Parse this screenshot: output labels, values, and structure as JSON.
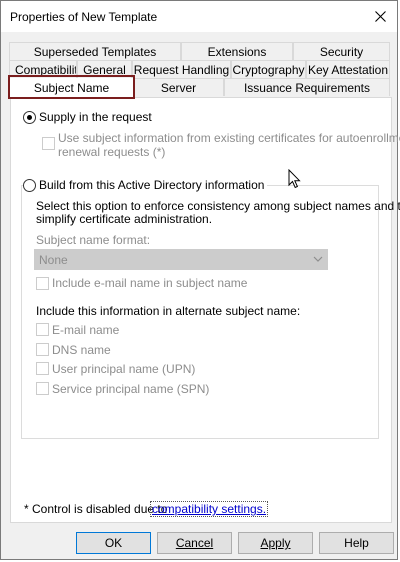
{
  "window": {
    "title": "Properties of New Template"
  },
  "tabs": {
    "row1": [
      {
        "label": "Superseded Templates"
      },
      {
        "label": "Extensions"
      },
      {
        "label": "Security"
      }
    ],
    "row2": [
      {
        "label": "Compatibility"
      },
      {
        "label": "General"
      },
      {
        "label": "Request Handling"
      },
      {
        "label": "Cryptography"
      },
      {
        "label": "Key Attestation"
      }
    ],
    "row3": [
      {
        "label": "Subject Name",
        "active": true
      },
      {
        "label": "Server"
      },
      {
        "label": "Issuance Requirements"
      }
    ]
  },
  "content": {
    "supply_label": "Supply in the request",
    "use_existing_line1": "Use subject information from existing certificates for autoenrollment",
    "use_existing_line2": "renewal requests (*)",
    "build_label": "Build from this Active Directory information",
    "build_desc_line1": "Select this option to enforce consistency among subject names and to",
    "build_desc_line2": "simplify certificate administration.",
    "format_label": "Subject name format:",
    "format_value": "None",
    "include_email_label": "Include e-mail name in subject name",
    "alt_heading": "Include this information in alternate subject name:",
    "alt_options": [
      {
        "label": "E-mail name"
      },
      {
        "label": "DNS name"
      },
      {
        "label": "User principal name (UPN)"
      },
      {
        "label": "Service principal name (SPN)"
      }
    ],
    "footnote_prefix": "* Control is disabled due to",
    "footnote_link": "compatibility settings."
  },
  "buttons": {
    "ok": "OK",
    "cancel": "Cancel",
    "apply": "Apply",
    "help": "Help"
  },
  "colors": {
    "active_tab_highlight": "#7b1e1e",
    "link": "#0000cc",
    "disabled_text": "#8d8d8d"
  }
}
